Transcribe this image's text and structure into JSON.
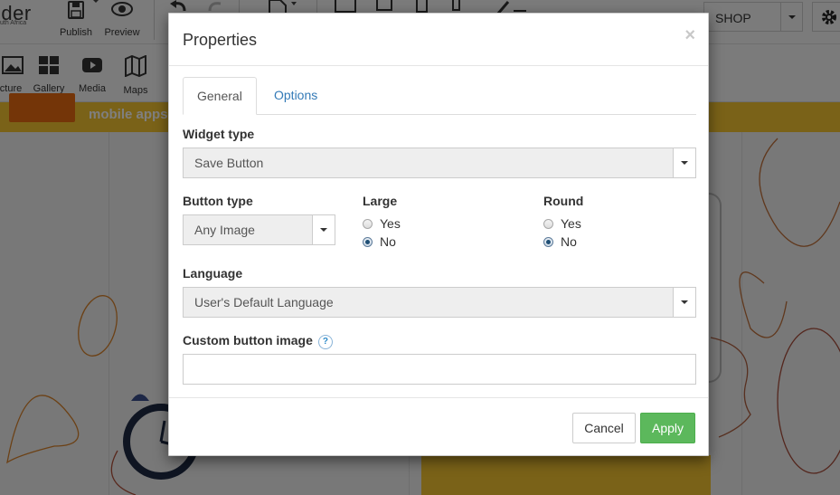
{
  "app": {
    "brand": {
      "name_fragment": "lder",
      "subtitle": "uth Africa"
    },
    "toolbar": {
      "publish_label": "Publish",
      "preview_label": "Preview",
      "shop_select_value": "SHOP"
    },
    "widgets": [
      {
        "label": "cture",
        "icon": "picture-icon"
      },
      {
        "label": "Gallery",
        "icon": "gallery-icon"
      },
      {
        "label": "Media",
        "icon": "media-icon"
      },
      {
        "label": "Maps",
        "icon": "maps-icon"
      }
    ],
    "canvas": {
      "banner_text": "mobile apps"
    }
  },
  "modal": {
    "title": "Properties",
    "close_glyph": "×",
    "tabs": [
      {
        "label": "General",
        "active": true
      },
      {
        "label": "Options",
        "active": false
      }
    ],
    "widget_type": {
      "label": "Widget type",
      "value": "Save Button"
    },
    "button_type": {
      "label": "Button type",
      "value": "Any Image"
    },
    "large": {
      "label": "Large",
      "options": [
        {
          "label": "Yes",
          "checked": false
        },
        {
          "label": "No",
          "checked": true
        }
      ]
    },
    "round": {
      "label": "Round",
      "options": [
        {
          "label": "Yes",
          "checked": false
        },
        {
          "label": "No",
          "checked": true
        }
      ]
    },
    "language": {
      "label": "Language",
      "value": "User's Default Language"
    },
    "custom_button_image": {
      "label": "Custom button image",
      "help_glyph": "?",
      "value": ""
    },
    "footer": {
      "cancel_label": "Cancel",
      "apply_label": "Apply"
    }
  },
  "colors": {
    "apply_green": "#5cb85c",
    "link_blue": "#337ab7",
    "banner_yellow": "#f4c430",
    "banner_orange": "#e86a10"
  }
}
